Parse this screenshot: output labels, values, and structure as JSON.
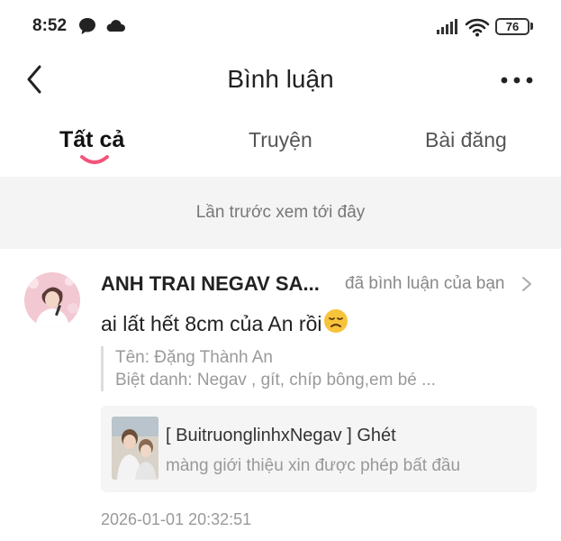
{
  "status_bar": {
    "time": "8:52",
    "battery": "76",
    "icons": [
      "chat-bubble-icon",
      "cloud-icon",
      "signal-icon",
      "wifi-icon",
      "battery-icon"
    ]
  },
  "header": {
    "title": "Bình luận",
    "back_icon": "chevron-left-icon",
    "more_icon": "more-dots-icon"
  },
  "tabs": [
    {
      "label": "Tất cả",
      "active": true
    },
    {
      "label": "Truyện",
      "active": false
    },
    {
      "label": "Bài đăng",
      "active": false
    }
  ],
  "last_seen_text": "Lần trước xem tới đây",
  "comment": {
    "author": "ANH TRAI NEGAV SA...",
    "action": "đã bình luận của bạn",
    "text": "ai lất hết 8cm của An rồi",
    "emoji": "disappointed-face-icon",
    "quote_lines": [
      "Tên: Đặng Thành An",
      "Biệt danh: Negav , gít, chíp bông,em bé ..."
    ],
    "ref": {
      "title": "[ BuitruonglinhxNegav ] Ghét",
      "subtitle": "màng giới thiệu xin được phép bất đầu"
    },
    "timestamp": "2026-01-01 20:32:51"
  },
  "colors": {
    "accent": "#f2547a",
    "band": "#f4f4f4",
    "card": "#f5f5f5"
  }
}
